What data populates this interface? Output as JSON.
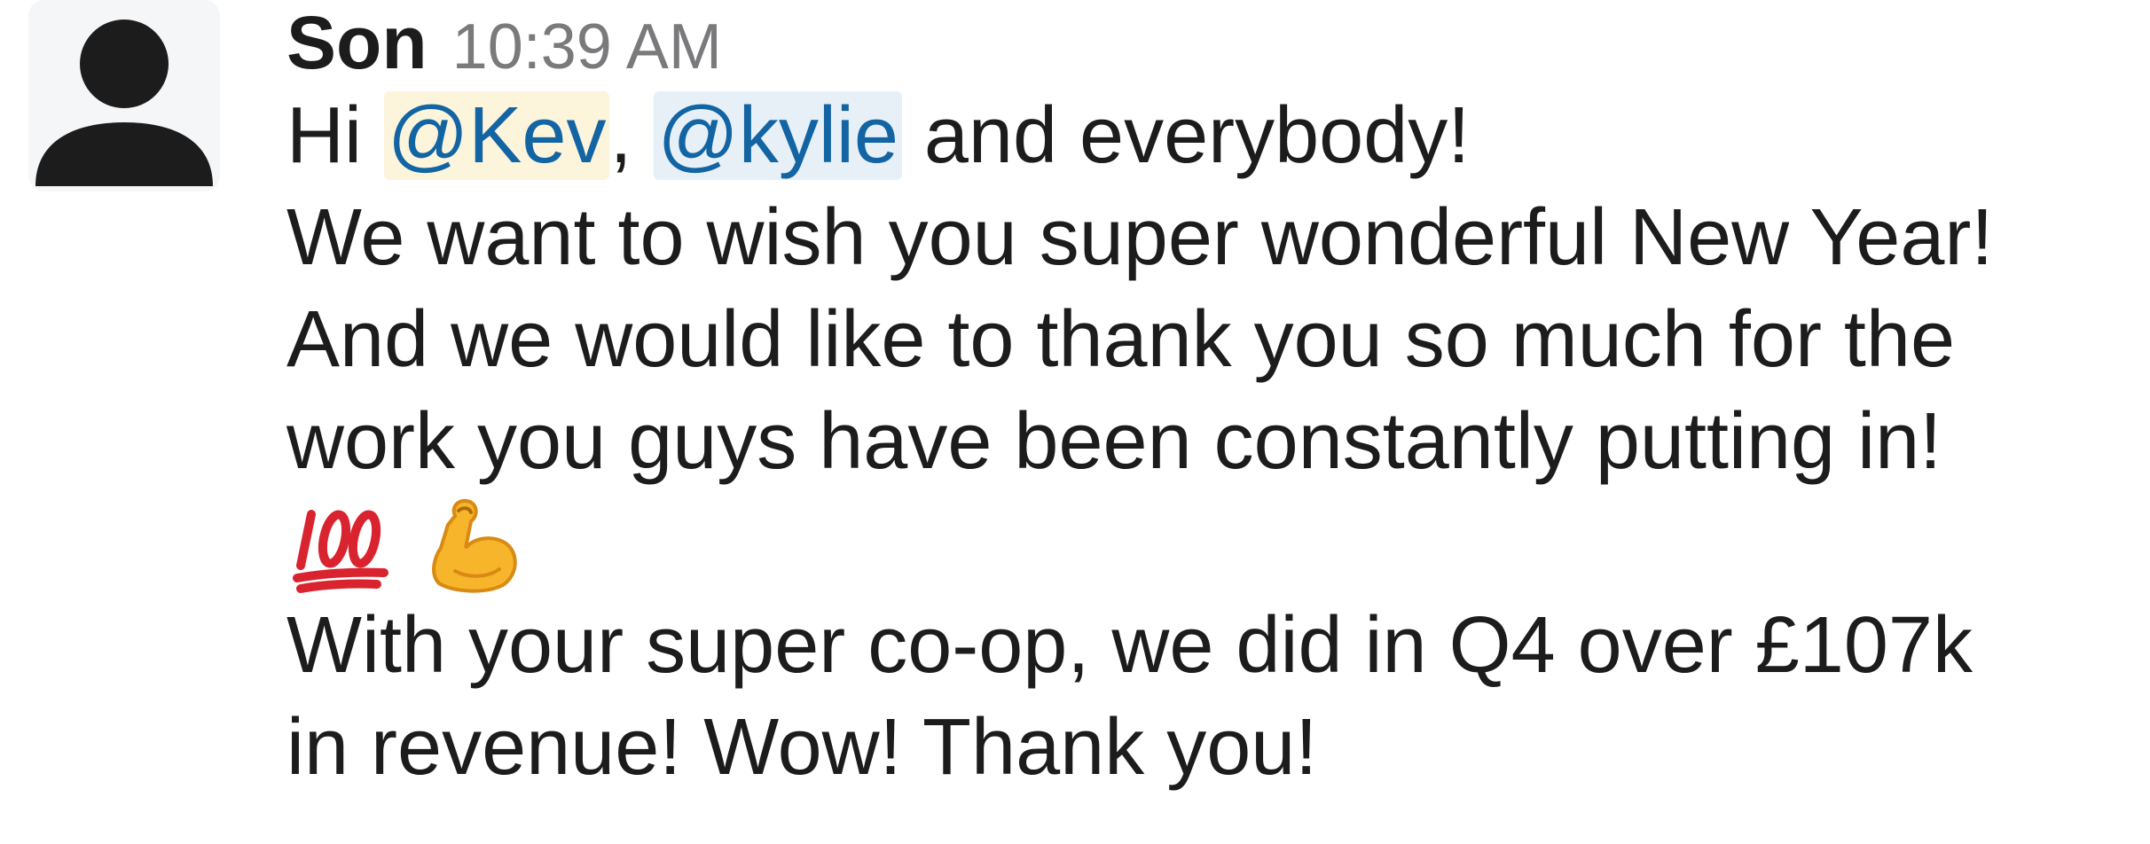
{
  "message": {
    "sender": "Son",
    "timestamp": "10:39 AM",
    "line1": {
      "prefix": "Hi ",
      "mention1": "@Kev",
      "separator": ", ",
      "mention2": "@kylie",
      "suffix": " and everybody!"
    },
    "line2": "We want to wish you super wonderful New Year!",
    "line3": "And we would like to thank you so much for the",
    "line4": "work you guys have been constantly putting in!",
    "emojis": [
      "hundred-points-emoji",
      "flexed-biceps-emoji"
    ],
    "line5": "With your super co-op, we did in Q4 over £107k",
    "line6": "in revenue! Wow! Thank you!"
  },
  "colors": {
    "text": "#1d1c1d",
    "timestamp": "#7a7a7d",
    "mention": "#1264a3",
    "mention_kev_bg": "#fdf4dc",
    "mention_kylie_bg": "#e8f0f7",
    "avatar_bg": "#f5f6f8"
  }
}
